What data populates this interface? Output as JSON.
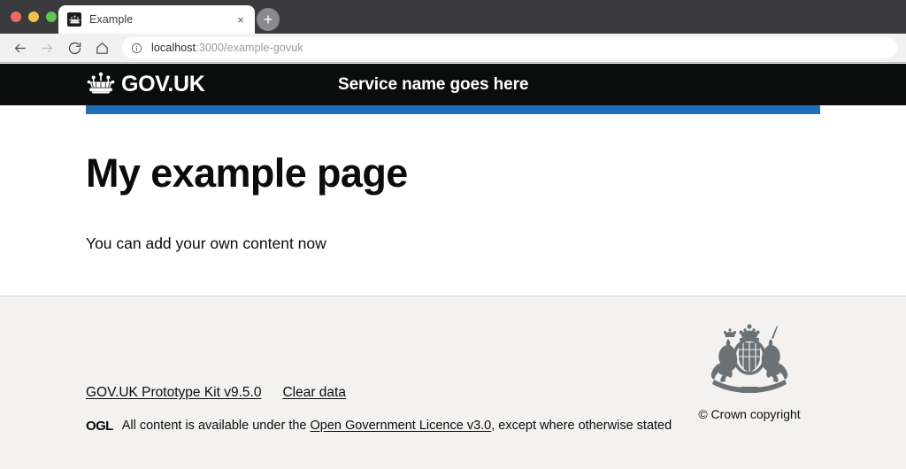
{
  "browser": {
    "window_controls": {
      "close_label": "close",
      "minimize_label": "minimize",
      "maximize_label": "maximize"
    },
    "tab": {
      "title": "Example",
      "favicon": "govuk-crown-favicon",
      "close_label": "×"
    },
    "new_tab_label": "+",
    "nav": {
      "back_label": "←",
      "forward_label": "→",
      "reload_label": "↻",
      "home_label": "⌂"
    },
    "omnibox": {
      "info_icon": "info-circle-icon",
      "url_host": "localhost",
      "url_path": ":3000/example-govuk",
      "url_full": "localhost:3000/example-govuk",
      "placeholder": "Search or type a URL"
    }
  },
  "header": {
    "logo_icon": "govuk-crown-icon",
    "logotype": "GOV.UK",
    "service_name": "Service name goes here",
    "background_color": "#0b0c0c",
    "accent_bar_color": "#1d70b8"
  },
  "main": {
    "heading": "My example page",
    "body": "You can add your own content now"
  },
  "footer": {
    "background_color": "#f3f2f1",
    "links": [
      {
        "label": "GOV.UK Prototype Kit v9.5.0"
      },
      {
        "label": "Clear data"
      }
    ],
    "licence": {
      "ogl_logo_text": "OGL",
      "prefix": "All content is available under the ",
      "link_label": "Open Government Licence v3.0",
      "suffix": ", except where otherwise stated"
    },
    "copyright": {
      "crest_icon": "royal-coat-of-arms-icon",
      "text": "© Crown copyright"
    }
  }
}
